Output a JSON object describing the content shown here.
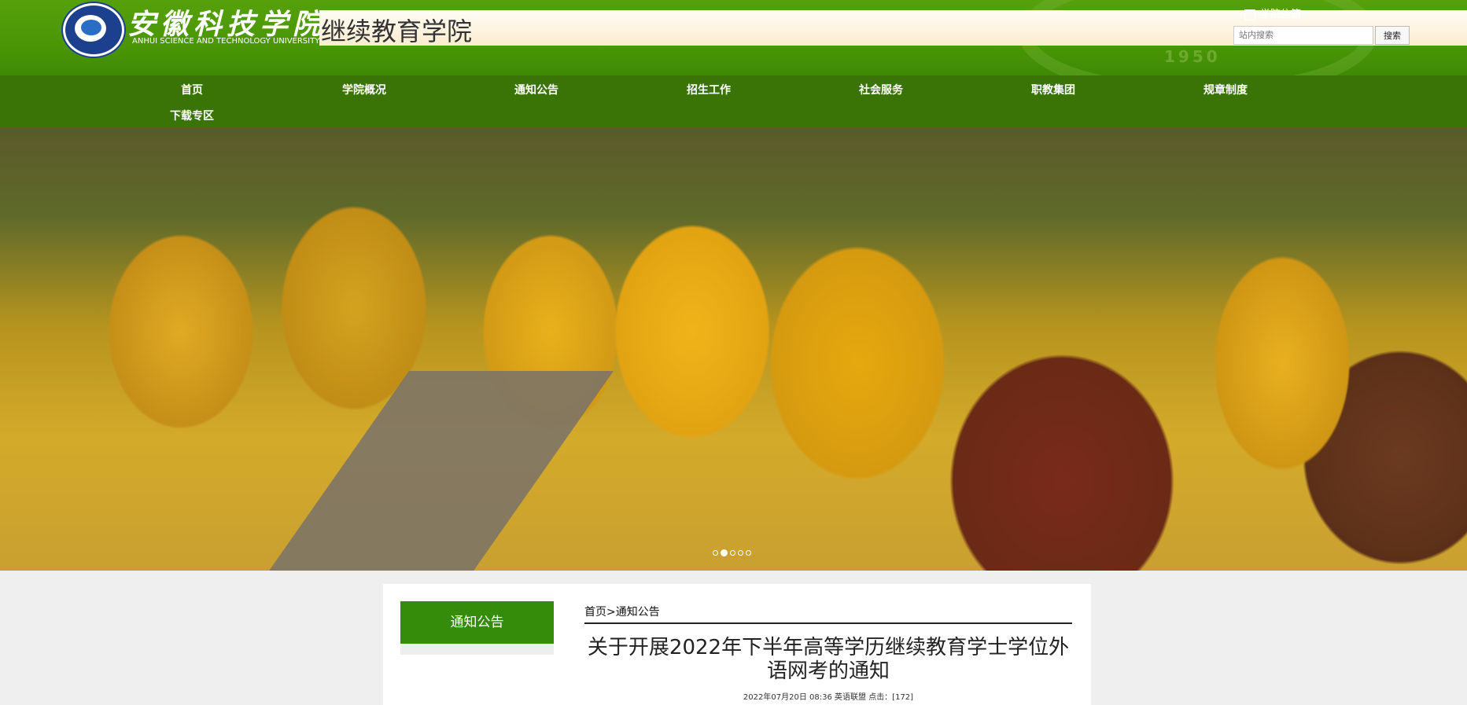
{
  "header": {
    "university_cn": "安徽科技学院",
    "university_en": "ANHUI SCIENCE AND TECHNOLOGY UNIVERSITY",
    "site_title": "继续教育学院",
    "seal_year": "1950",
    "top_link": "学院信箱",
    "search": {
      "placeholder": "站内搜索",
      "button_label": "搜索"
    }
  },
  "nav": {
    "items": [
      {
        "label": "首页"
      },
      {
        "label": "学院概况"
      },
      {
        "label": "通知公告"
      },
      {
        "label": "招生工作"
      },
      {
        "label": "社会服务"
      },
      {
        "label": "职教集团"
      },
      {
        "label": "规章制度"
      },
      {
        "label": "下载专区"
      }
    ]
  },
  "banner": {
    "slide_count": 5,
    "active_index": 1
  },
  "sidebar": {
    "heading": "通知公告"
  },
  "article": {
    "breadcrumb": "首页>通知公告",
    "title": "关于开展2022年下半年高等学历继续教育学士学位外语网考的通知",
    "meta": "2022年07月20日 08:36 英语联盟 点击：[172]"
  },
  "colors": {
    "header_green": "#4a9607",
    "nav_green": "#3a7406",
    "accent_green": "#358c0a"
  }
}
